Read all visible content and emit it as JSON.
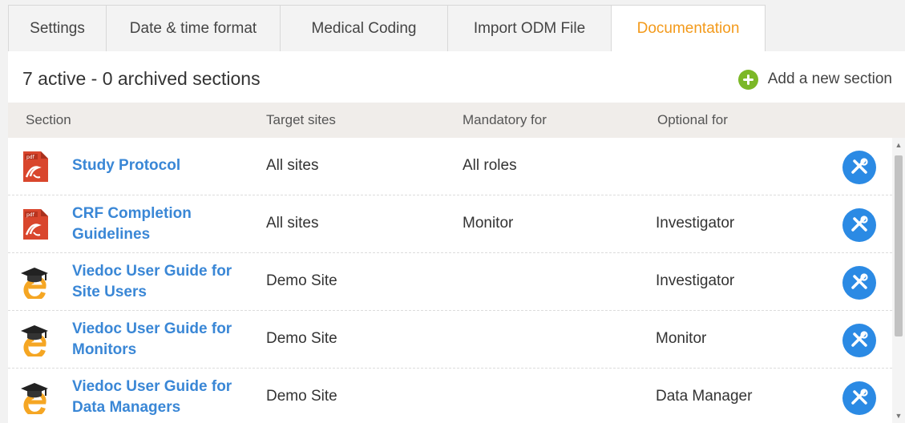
{
  "tabs": [
    {
      "label": "Settings",
      "active": false
    },
    {
      "label": "Date & time format",
      "active": false
    },
    {
      "label": "Medical Coding",
      "active": false
    },
    {
      "label": "Import ODM File",
      "active": false
    },
    {
      "label": "Documentation",
      "active": true
    }
  ],
  "summary": {
    "title": "7 active - 0 archived sections",
    "add_label": "Add a new section"
  },
  "columns": {
    "section": "Section",
    "target_sites": "Target sites",
    "mandatory_for": "Mandatory for",
    "optional_for": "Optional for"
  },
  "rows": [
    {
      "icon": "pdf-icon",
      "section": "Study Protocol",
      "target_sites": "All sites",
      "mandatory_for": "All roles",
      "optional_for": ""
    },
    {
      "icon": "pdf-icon",
      "section": "CRF Completion Guidelines",
      "target_sites": "All sites",
      "mandatory_for": "Monitor",
      "optional_for": "Investigator"
    },
    {
      "icon": "elearning-icon",
      "section": "Viedoc User Guide for Site Users",
      "target_sites": "Demo Site",
      "mandatory_for": "",
      "optional_for": "Investigator"
    },
    {
      "icon": "elearning-icon",
      "section": "Viedoc User Guide for Monitors",
      "target_sites": "Demo Site",
      "mandatory_for": "",
      "optional_for": "Monitor"
    },
    {
      "icon": "elearning-icon",
      "section": "Viedoc User Guide for Data Managers",
      "target_sites": "Demo Site",
      "mandatory_for": "",
      "optional_for": "Data Manager"
    }
  ],
  "colors": {
    "active_tab": "#f39a1b",
    "link": "#3a87d6",
    "add_icon": "#7cb827",
    "tool_button": "#2b8ae4",
    "header_bg": "#f0edea",
    "pdf_red": "#d9462d",
    "elearning_orange": "#f5a623"
  }
}
